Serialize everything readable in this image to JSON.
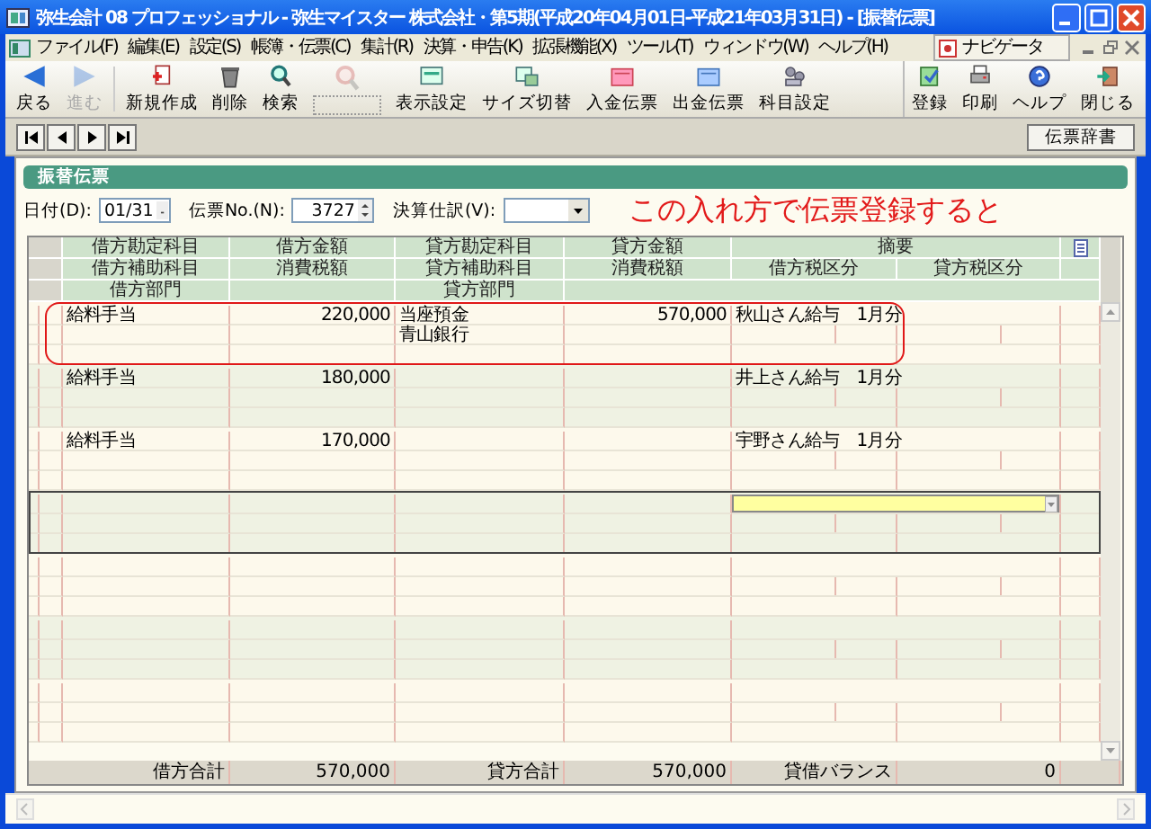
{
  "window": {
    "title": "弥生会計 08 プロフェッショナル - 弥生マイスター 株式会社・第5期(平成20年04月01日-平成21年03月31日) - [振替伝票]"
  },
  "menu": [
    "ファイル(F)",
    "編集(E)",
    "設定(S)",
    "帳簿・伝票(C)",
    "集計(R)",
    "決算・申告(K)",
    "拡張機能(X)",
    "ツール(T)",
    "ウィンドウ(W)",
    "ヘルプ(H)"
  ],
  "navigator": "ナビゲータ",
  "toolbar": {
    "left": [
      {
        "label": "戻る",
        "kind": "back",
        "disabled": false
      },
      {
        "label": "進む",
        "kind": "forward",
        "disabled": true
      },
      {
        "label": "新規作成",
        "kind": "new",
        "disabled": false
      },
      {
        "label": "削除",
        "kind": "delete",
        "disabled": false
      },
      {
        "label": "検索",
        "kind": "search",
        "disabled": false
      },
      {
        "kind": "dictionary",
        "disabled": true
      },
      {
        "label": "表示設定",
        "kind": "display",
        "disabled": false
      },
      {
        "label": "サイズ切替",
        "kind": "resize",
        "disabled": false
      },
      {
        "label": "入金伝票",
        "kind": "receipt",
        "disabled": false
      },
      {
        "label": "出金伝票",
        "kind": "payment",
        "disabled": false
      },
      {
        "label": "科目設定",
        "kind": "accounts",
        "disabled": false
      }
    ],
    "right": [
      {
        "label": "登録",
        "kind": "register",
        "disabled": false
      },
      {
        "label": "印刷",
        "kind": "print",
        "disabled": false
      },
      {
        "label": "ヘルプ",
        "kind": "help",
        "disabled": false
      },
      {
        "label": "閉じる",
        "kind": "close",
        "disabled": false
      }
    ]
  },
  "nav_buttons": [
    {
      "kind": "first"
    },
    {
      "kind": "prev"
    },
    {
      "kind": "next"
    },
    {
      "kind": "last"
    }
  ],
  "dictionary_button": "伝票辞書",
  "slip_title": "振替伝票",
  "fields": {
    "date": {
      "label": "日付(D):",
      "value": "01/31"
    },
    "number": {
      "label": "伝票No.(N):",
      "value": "3727"
    },
    "closing": {
      "label": "決算仕訳(V):"
    }
  },
  "annotation": "この入れ方で伝票登録すると",
  "table": {
    "header": [
      [
        "借方勘定科目",
        "借方金額",
        "貸方勘定科目",
        "貸方金額",
        "摘要"
      ],
      [
        "借方補助科目",
        "消費税額",
        "貸方補助科目",
        "消費税額",
        "借方税区分",
        "貸方税区分"
      ],
      [
        "借方部門",
        "貸方部門"
      ]
    ],
    "rows": [
      {
        "debit_account": "給料手当",
        "debit_amount": "220,000",
        "credit_account": "当座預金",
        "credit_amount": "570,000",
        "memo": "秋山さん給与　1月分",
        "credit_sub": "青山銀行",
        "selected": false,
        "circled": true
      },
      {
        "debit_account": "給料手当",
        "debit_amount": "180,000",
        "memo": "井上さん給与　1月分",
        "selected": false,
        "circled": false
      },
      {
        "debit_account": "給料手当",
        "debit_amount": "170,000",
        "memo": "宇野さん給与　1月分",
        "selected": false,
        "circled": false
      },
      {
        "selected": true,
        "circled": false
      }
    ],
    "totals": {
      "debit_label": "借方合計",
      "debit_value": "570,000",
      "credit_label": "貸方合計",
      "credit_value": "570,000",
      "balance_label": "貸借バランス",
      "balance_value": "0"
    }
  }
}
